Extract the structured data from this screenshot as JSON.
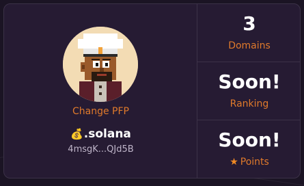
{
  "profile": {
    "change_pfp_label": "Change PFP",
    "domain_emoji": "💰",
    "domain_name": ".solana",
    "address": "4msgK...QJd5B",
    "avatar_icon": "pixel-chef-avatar"
  },
  "stats": {
    "domains": {
      "value": "3",
      "label": "Domains"
    },
    "ranking": {
      "value": "Soon!",
      "label": "Ranking"
    },
    "points": {
      "value": "Soon!",
      "label": "Points",
      "icon": "star-icon"
    }
  },
  "colors": {
    "accent": "#e07a2b",
    "card_bg": "#261b33",
    "page_bg": "#1b1424",
    "border": "#3c3248"
  }
}
